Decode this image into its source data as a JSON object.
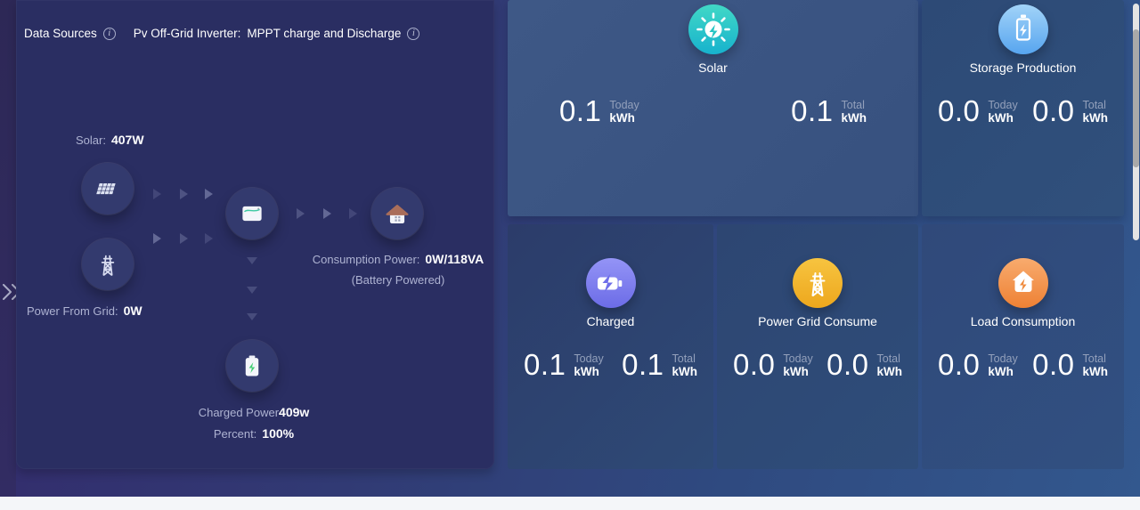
{
  "header": {
    "data_sources_label": "Data Sources",
    "inverter_label": "Pv Off-Grid Inverter:",
    "inverter_value": "MPPT charge and Discharge",
    "info_glyph": "i"
  },
  "flow": {
    "solar_label": "Solar:",
    "solar_value": "407W",
    "grid_label": "Power From Grid:",
    "grid_value": "0W",
    "consumption_label": "Consumption Power:",
    "consumption_value": "0W/118VA",
    "battery_note": "(Battery Powered)",
    "charged_label": "Charged Power",
    "charged_value": "409w",
    "percent_label": "Percent:",
    "percent_value": "100%"
  },
  "cards": [
    {
      "title": "Solar",
      "today_label": "Today",
      "today_value": "0.1",
      "total_label": "Total",
      "total_value": "0.1",
      "unit": "kWh",
      "accent": "#2bc9c6"
    },
    {
      "title": "Storage Production",
      "today_label": "Today",
      "today_value": "0.0",
      "total_label": "Total",
      "total_value": "0.0",
      "unit": "kWh",
      "accent": "#74b7f3"
    },
    {
      "title": "Charged",
      "today_label": "Today",
      "today_value": "0.1",
      "total_label": "Total",
      "total_value": "0.1",
      "unit": "kWh",
      "accent": "#7d7df0"
    },
    {
      "title": "Power Grid Consume",
      "today_label": "Today",
      "today_value": "0.0",
      "total_label": "Total",
      "total_value": "0.0",
      "unit": "kWh",
      "accent": "#f2b232"
    },
    {
      "title": "Load Consumption",
      "today_label": "Today",
      "today_value": "0.0",
      "total_label": "Total",
      "total_value": "0.0",
      "unit": "kWh",
      "accent": "#f2914e"
    }
  ],
  "colors": {
    "page_gradient_start": "#34296b",
    "page_gradient_end": "#33588e",
    "panel_bg": "#2a2e62",
    "footer_strip": "#f4f6f9",
    "accent_solar": "#2bc9c6",
    "accent_storage": "#74b7f3",
    "accent_charged": "#7d7df0",
    "accent_grid_consume": "#f2b232",
    "accent_load": "#f2914e",
    "battery_bolt_green": "#43ce74",
    "house_roof_brown": "#aa6e5a"
  }
}
